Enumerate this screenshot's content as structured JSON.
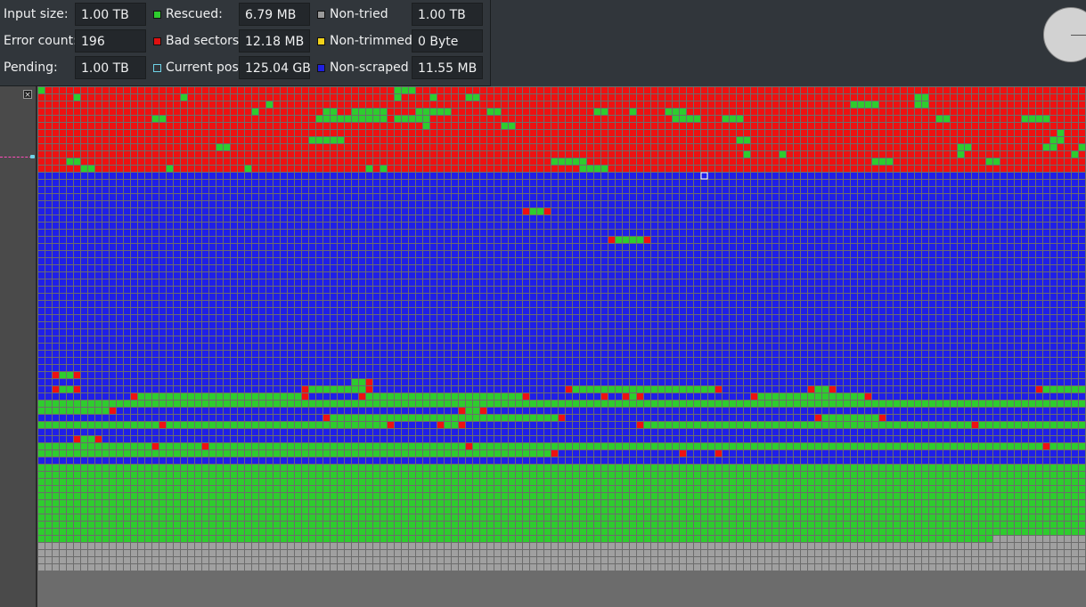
{
  "stats": {
    "input_size": {
      "label": "Input size:",
      "value": "1.00 TB"
    },
    "error_count": {
      "label": "Error count:",
      "value": "196"
    },
    "pending": {
      "label": "Pending:",
      "value": "1.00 TB"
    },
    "rescued": {
      "label": "Rescued:",
      "value": "6.79 MB",
      "color": "#2ecc2e"
    },
    "bad_sectors": {
      "label": "Bad sectors:",
      "value": "12.18 MB",
      "color": "#e01010"
    },
    "current_pos": {
      "label": "Current pos:",
      "value": "125.04 GB",
      "color": "#31363b",
      "border": "#6fd3e8"
    },
    "non_tried": {
      "label": "Non-tried",
      "value": "1.00 TB",
      "color": "#9a9a9a"
    },
    "non_trimmed": {
      "label": "Non-trimmed",
      "value": "0 Byte",
      "color": "#f2d21a"
    },
    "non_scraped": {
      "label": "Non-scraped",
      "value": "11.55 MB",
      "color": "#1f1fe0"
    }
  },
  "colors": {
    "rescued": "#2ecc2e",
    "bad": "#ee1111",
    "non_scraped": "#1f1fe8",
    "non_tried": "#a0a0a0",
    "current": "#ffffff"
  },
  "icons": {
    "clock": "progress-clock-icon",
    "close": "close-icon"
  },
  "blockmap": {
    "legend_order": [
      "rescued",
      "bad",
      "non_scraped",
      "non_tried"
    ],
    "current_block": "current position marker",
    "description_of_states": {
      "R": "bad",
      "G": "rescued",
      "B": "non_scraped",
      "T": "non_tried",
      "C": "current"
    },
    "rows": [
      "GRRRRRRRRRRRRRRRRRRRRRRRRRRRRRRRRRRRRRRRRRRRRRRRRRGGGRRRRRRRRRRRRRRRRRRRRRRRRRRRRRRRRRRRRRRRRRRRRRRRRRRRRRRRRRRRRRRRRRRRRRRRRRRRRRRRRRRRRRRRRRRRRRRR",
      "RRRRRGRRRRRRRRRRRRRRGRRRRRRRRRRRRRRRRRRRRRRRRRRRRRGRRRRGRRRRGGRRRRRRRRRRRRRRRRRRRRRRRRRRRRRRRRRRRRRRRRRRRRRRRRRRRRRRRRRRRRRGGRRRRRRRRRRRRRRRRRRRRRRR",
      "RRRRRRRRRRRRRRRRRRRRRRRRRRRRRRRRGRRRRRRRRRRRRRRRRRRRRRRRRRRRRRRRRRRRRRRRRRRRRRRRRRRRRRRRRRRRRRRRRRRRRRRRRRRRRRRRRRGGGGRRRRRGGRRRRRRRRRRRRRRRRRRRRRRR",
      "RRRRRRRRRRRRRRRRRRRRRRRRRRRRRRGRRRRRRRRRGGRRGGGGGRRRRGGGGGRRRRRGGRRRRRRRRRRRRRGGRRRGRRRRGGGRRRRRRRRRRRRRRRRRRRRRRRRRRRRRRRRRRRRRRRRRRRRRRRRRRRRRRRRRR",
      "RRRRRRRRRRRRRRRRGGRRRRRRRRRRRRRRRRRRRRRGGGGGGGGGGRGGGGGRRRRRRRRRRRRRRRRRRRRRRRRRRRRRRRRRRGGGGRRRGGGRRRRRRRRRRRRRRRRRRRRRRRRRRRGGRRRRRRRRRRGGGGRRRRRRRRR",
      "RRRRRRRRRRRRRRRRRRRRRRRRRRRRRRRRRRRRRRRRRRRRRRRRRRRRRRGRRRRRRRRRRGGRRRRRRRRRRRRRRRRRRRRRRRRRRRRRRRRRRRRRRRRRRRRRRRRRRRRRRRRRRRRRRRRRRRRRRRRRRRRRRRRRR",
      "RRRRRRRRRRRRRRRRRRRRRRRRRRRRRRRRRRRRRRRRRRRRRRRRRRRRRRRRRRRRRRRRRRRRRRRRRRRRRRRRRRRRRRRRRRRRRRRRRRRRRRRRRRRRRRRRRRRRRRRRRRRRRRRRRRRRRRRRRRRRRRRGRRRRRR",
      "RRRRRRRRRRRRRRRRRRRRRRRRRRRRRRRRRRRRRRGGGGGRRRRRRRRRRRRRRRRRRRRRRRRRRRRRRRRRRRRRRRRRRRRRRRRRRRRRRRGGRRRRRRRRRRRRRRRRRRRRRRRRRRRRRRRRRRRRRRRRRRGGRRRRRGRR",
      "RRRRRRRRRRRRRRRRRRRRRRRRRGGRRRRRRRRRRRRRRRRRRRRRRRRRRRRRRRRRRRRRRRRRRRRRRRRRRRRRRRRRRRRRRRRRRRRRRRRRRRRRRRRRRRRRRRRRRRRRRRRRRRRRRGGRRRRRRRRRRGGRRRGRRRR",
      "RRRRRRRRRRRRRRRRRRRRRRRRRRRRRRRRRRRRRRRRRRRRRRRRRRRRRRRRRRRRRRRRRRRRRRRRRRRRRRRRRRRRRRRRRRRRRRRRRRRGRRRRGRRRRRRRRRRRRRRRRRRRRRRRRGRRRRRRRRRRRRRRRGRRGGRR",
      "RRRRGGRRRRRRRRRRRRRRRRRRRRRRRRRRRRRRRRRRRRRRRRRRRRRRRRRRRRRRRRRRRRRRRRRRGGGGGRRRRRRRRRRRRRRRRRRRRRRRRRRRRRRRRRRRRRRRRGGGRRRRRRRRRRRRRGGRRRRRRRRRRRRRRR",
      "RRRRRRGGRRRRRRRRRRGRRRRRRRRRRGRRRRRRRRRRRRRRRRGRGRRRRRRRRRRRRRRRRRRRRRRRRRRRGGGGRRRRRRRRRRRRRRRRRRRRRRRRRRRRRRRRRRRRRRRRRRRRRRRRRRRRRRRRRRRRRRRRRRRRRR",
      "BBBBBBBBBBBBBBBBBBBBBBBBBBBBBBBBBBBBBBBBBBBBBBBBBBBBBBBBBBBBBBBBBBBBBBBBBBBBBBBBBBBBBBBBBBBBBCBBBBBBBBBBBBBBBBBBBBBBBBBBBBBBBBBBBBBBBBBBBBBBBBBBBBBBB"
    ]
  }
}
